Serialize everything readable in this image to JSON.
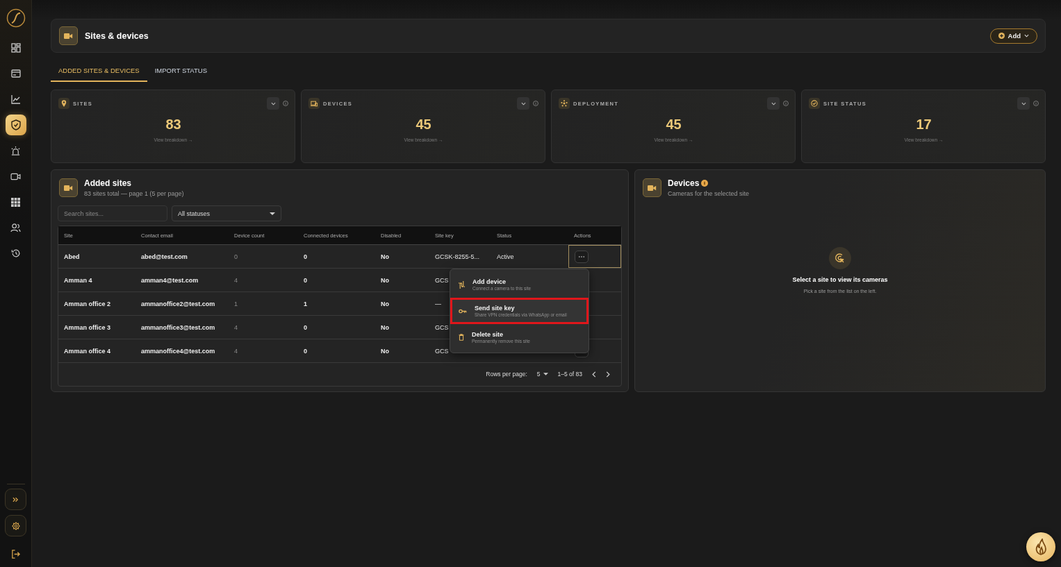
{
  "sidebar": {
    "items": [
      {
        "kind": "dashboard",
        "selected": false
      },
      {
        "kind": "card",
        "selected": false
      },
      {
        "kind": "chart",
        "selected": false
      },
      {
        "kind": "shield",
        "selected": true
      },
      {
        "kind": "siren",
        "selected": false
      },
      {
        "kind": "video",
        "selected": false
      },
      {
        "kind": "qr",
        "selected": false
      },
      {
        "kind": "users",
        "selected": false
      },
      {
        "kind": "history",
        "selected": false
      }
    ]
  },
  "header": {
    "title": "Sites & devices",
    "add_button": "Add"
  },
  "tabs": [
    {
      "label": "ADDED SITES & DEVICES",
      "selected": true
    },
    {
      "label": "IMPORT STATUS",
      "selected": false
    }
  ],
  "stats": [
    {
      "kind": "sites",
      "label": "SITES",
      "value": "83",
      "link": "View breakdown →"
    },
    {
      "kind": "devices",
      "label": "DEVICES",
      "value": "45",
      "link": "View breakdown →"
    },
    {
      "kind": "deployment",
      "label": "DEPLOYMENT",
      "value": "45",
      "link": "View breakdown →"
    },
    {
      "kind": "status",
      "label": "SITE STATUS",
      "value": "17",
      "link": "View breakdown →"
    }
  ],
  "sites_panel": {
    "title": "Added sites",
    "subtitle": "83 sites total — page 1 (5 per page)",
    "search": {
      "placeholder": "Search sites..."
    },
    "status_filter": "All statuses",
    "columns": [
      "Site",
      "Contact email",
      "Device count",
      "Connected devices",
      "Disabled",
      "Site key",
      "Status",
      "Actions"
    ],
    "rows": [
      {
        "site": "Abed",
        "email": "abed@test.com",
        "device_count": "0",
        "connected": "0",
        "disabled": "No",
        "site_key": "GCSK-8255-5...",
        "status": "Active",
        "actions_open": true
      },
      {
        "site": "Amman 4",
        "email": "amman4@test.com",
        "device_count": "4",
        "connected": "0",
        "disabled": "No",
        "site_key": "GCS"
      },
      {
        "site": "Amman office 2",
        "email": "ammanoffice2@test.com",
        "device_count": "1",
        "connected": "1",
        "disabled": "No",
        "site_key": "—"
      },
      {
        "site": "Amman office 3",
        "email": "ammanoffice3@test.com",
        "device_count": "4",
        "connected": "0",
        "disabled": "No",
        "site_key": "GCS"
      },
      {
        "site": "Amman office 4",
        "email": "ammanoffice4@test.com",
        "device_count": "4",
        "connected": "0",
        "disabled": "No",
        "site_key": "GCS",
        "actions_open": false
      }
    ],
    "menu": {
      "items": [
        {
          "kind": "add",
          "title": "Add device",
          "description": "Connect a camera to this site",
          "selected": false
        },
        {
          "kind": "key",
          "title": "Send site key",
          "description": "Share VPN credentials via WhatsApp or email",
          "selected": true
        },
        {
          "kind": "delete",
          "title": "Delete site",
          "description": "Permanently remove this site",
          "selected": false
        }
      ]
    },
    "pagination": {
      "rows_per_page_label": "Rows per page:",
      "rows_per_page": "5",
      "range": "1–5 of 83"
    }
  },
  "devices_panel": {
    "title": "Devices",
    "subtitle": "Cameras for the selected site",
    "empty_title": "Select a site to view its cameras",
    "empty_hint": "Pick a site from the list on the left."
  }
}
